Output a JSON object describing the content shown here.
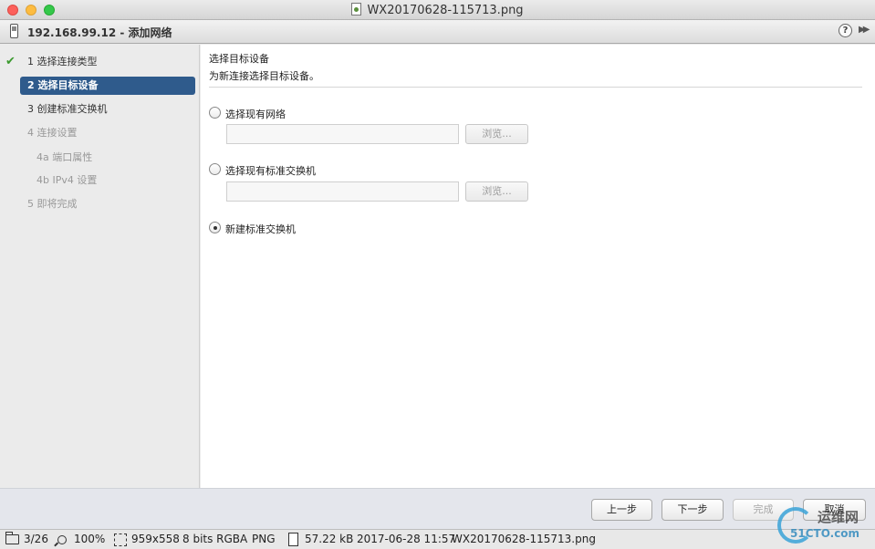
{
  "window": {
    "title": "WX20170628-115713.png"
  },
  "dialog": {
    "title": "192.168.99.12 - 添加网络",
    "help_label": "?",
    "expand_label": "▶▶"
  },
  "nav": {
    "steps": [
      {
        "label": "1 选择连接类型",
        "state": "done"
      },
      {
        "label": "2 选择目标设备",
        "state": "active"
      },
      {
        "label": "3 创建标准交换机",
        "state": "normal"
      },
      {
        "label": "4 连接设置",
        "state": "disabled"
      },
      {
        "label": "4a 端口属性",
        "state": "disabled"
      },
      {
        "label": "4b IPv4 设置",
        "state": "disabled"
      },
      {
        "label": "5 即将完成",
        "state": "disabled"
      }
    ],
    "check_glyph": "✔"
  },
  "content": {
    "title": "选择目标设备",
    "subtitle": "为新连接选择目标设备。",
    "options": [
      {
        "label": "选择现有网络",
        "checked": false,
        "field_value": "",
        "browse_label": "浏览..."
      },
      {
        "label": "选择现有标准交换机",
        "checked": false,
        "field_value": "",
        "browse_label": "浏览..."
      },
      {
        "label": "新建标准交换机",
        "checked": true
      }
    ]
  },
  "footer": {
    "back_label": "上一步",
    "next_label": "下一步",
    "finish_label": "完成",
    "cancel_label": "取消"
  },
  "statusbar": {
    "index": "3/26",
    "zoom": "100%",
    "dimensions": "959x558",
    "color_depth": "8 bits RGBA",
    "format": "PNG",
    "file_size": "57.22 kB",
    "timestamp": "2017-06-28 11:57",
    "filename": "WX20170628-115713.png"
  },
  "watermark": {
    "text": "运维网",
    "sub": "51CTO.com"
  },
  "colors": {
    "active_step": "#2f5b8c",
    "check": "#3c9a2f",
    "mac_red": "#fc605b",
    "mac_yellow": "#fdbc40",
    "mac_green": "#34c84a"
  }
}
